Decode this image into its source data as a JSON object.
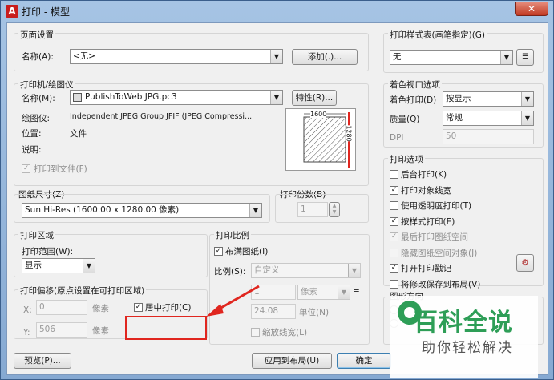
{
  "window": {
    "title": "打印 - 模型",
    "close_glyph": "✕",
    "app_icon_glyph": "A"
  },
  "page_setup": {
    "group": "页面设置",
    "name_label": "名称(A):",
    "name_value": "<无>",
    "add_button": "添加(.)..."
  },
  "printer": {
    "group": "打印机/绘图仪",
    "name_label": "名称(M):",
    "name_value": "PublishToWeb JPG.pc3",
    "properties_button": "特性(R)...",
    "plotter_label": "绘图仪:",
    "plotter_value": "Independent JPEG Group JFIF (JPEG Compressi...",
    "location_label": "位置:",
    "location_value": "文件",
    "description_label": "说明:",
    "print_to_file": "打印到文件(F)",
    "preview_width": "1600",
    "preview_height": "1280"
  },
  "paper_size": {
    "group": "图纸尺寸(Z)",
    "value": "Sun Hi-Res (1600.00 x 1280.00 像素)"
  },
  "copies": {
    "group": "打印份数(B)",
    "value": "1"
  },
  "plot_area": {
    "group": "打印区域",
    "range_label": "打印范围(W):",
    "range_value": "显示"
  },
  "plot_offset": {
    "group": "打印偏移(原点设置在可打印区域)",
    "x_label": "X:",
    "x_value": "0",
    "x_unit": "像素",
    "y_label": "Y:",
    "y_value": "506",
    "y_unit": "像素",
    "center_label": "居中打印(C)"
  },
  "plot_scale": {
    "group": "打印比例",
    "fit_label": "布满图纸(I)",
    "scale_label": "比例(S):",
    "scale_value": "自定义",
    "val1": "1",
    "unit1": "像素",
    "equals": "=",
    "val2": "24.08",
    "unit2": "单位(N)",
    "lineweights": "缩放线宽(L)"
  },
  "plot_style": {
    "group": "打印样式表(画笔指定)(G)",
    "value": "无"
  },
  "shaded": {
    "group": "着色视口选项",
    "shade_label": "着色打印(D)",
    "shade_value": "按显示",
    "quality_label": "质量(Q)",
    "quality_value": "常规",
    "dpi_label": "DPI",
    "dpi_value": "50"
  },
  "options": {
    "group": "打印选项",
    "items": [
      {
        "label": "后台打印(K)",
        "checked": "",
        "disabled": false
      },
      {
        "label": "打印对象线宽",
        "checked": "✓",
        "disabled": false
      },
      {
        "label": "使用透明度打印(T)",
        "checked": "",
        "disabled": false
      },
      {
        "label": "按样式打印(E)",
        "checked": "✓",
        "disabled": false
      },
      {
        "label": "最后打印图纸空间",
        "checked": "✓",
        "disabled": true
      },
      {
        "label": "隐藏图纸空间对象(J)",
        "checked": "",
        "disabled": true
      },
      {
        "label": "打开打印戳记",
        "checked": "✓",
        "disabled": false
      },
      {
        "label": "将修改保存到布局(V)",
        "checked": "",
        "disabled": false
      }
    ]
  },
  "orientation": {
    "group": "图形方向"
  },
  "footer": {
    "preview_button": "预览(P)...",
    "apply_button": "应用到布局(U)",
    "ok_button": "确定"
  },
  "watermark": {
    "title": "百科全说",
    "subtitle": "助你轻松解决"
  }
}
